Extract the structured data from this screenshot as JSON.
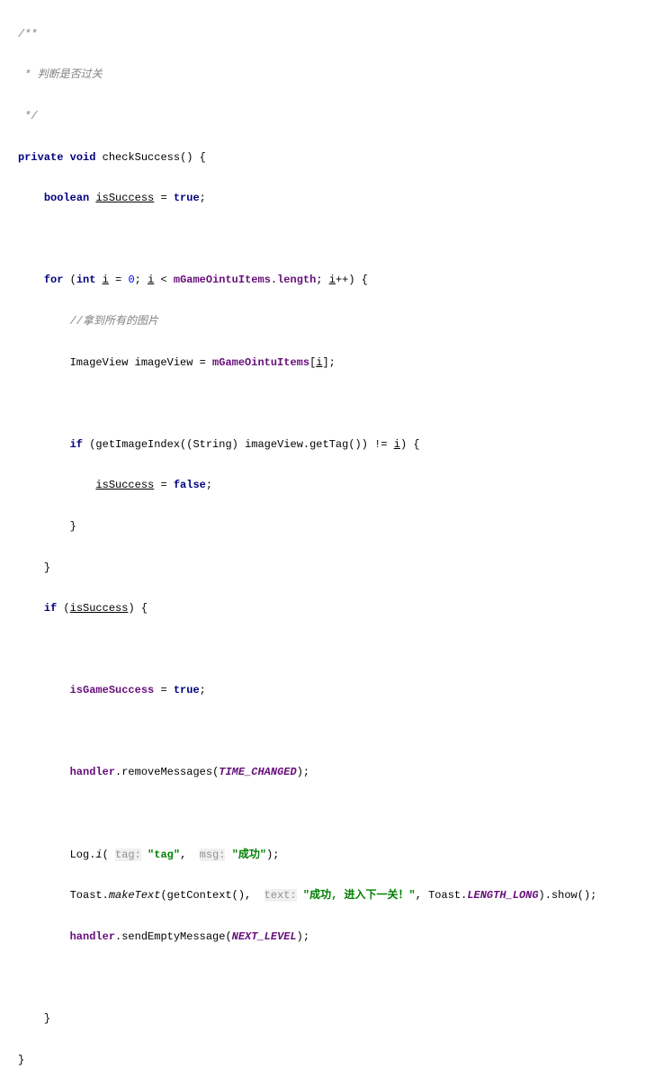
{
  "code": {
    "comment_open": "/**",
    "comment_body": " * 判断是否过关",
    "comment_close": " */",
    "kw_private": "private",
    "kw_void": "void",
    "method_name": "checkSuccess",
    "kw_boolean": "boolean",
    "var_isSuccess": "isSuccess",
    "kw_true": "true",
    "kw_for": "for",
    "kw_int": "int",
    "var_i": "i",
    "num_zero": "0",
    "field_items": "mGameOintuItems",
    "prop_length": "length",
    "comment_inner": "//拿到所有的图片",
    "type_ImageView": "ImageView",
    "var_imageView": "imageView",
    "kw_if": "if",
    "method_getImageIndex": "getImageIndex",
    "type_String": "String",
    "method_getTag": "getTag",
    "kw_false": "false",
    "field_isGameSuccess": "isGameSuccess",
    "field_handler": "handler",
    "method_removeMessages": "removeMessages",
    "const_TIME_CHANGED": "TIME_CHANGED",
    "class_Log": "Log",
    "method_i": "i",
    "hint_tag": "tag:",
    "str_tag": "\"tag\"",
    "hint_msg": "msg:",
    "str_success": "\"成功\"",
    "class_Toast": "Toast",
    "method_makeText": "makeText",
    "method_getContext": "getContext",
    "hint_text": "text:",
    "str_toast": "\"成功, 进入下一关！\"",
    "const_LENGTH_LONG": "LENGTH_LONG",
    "method_show": "show",
    "method_sendEmptyMessage": "sendEmptyMessage",
    "const_NEXT_LEVEL": "NEXT_LEVEL"
  }
}
